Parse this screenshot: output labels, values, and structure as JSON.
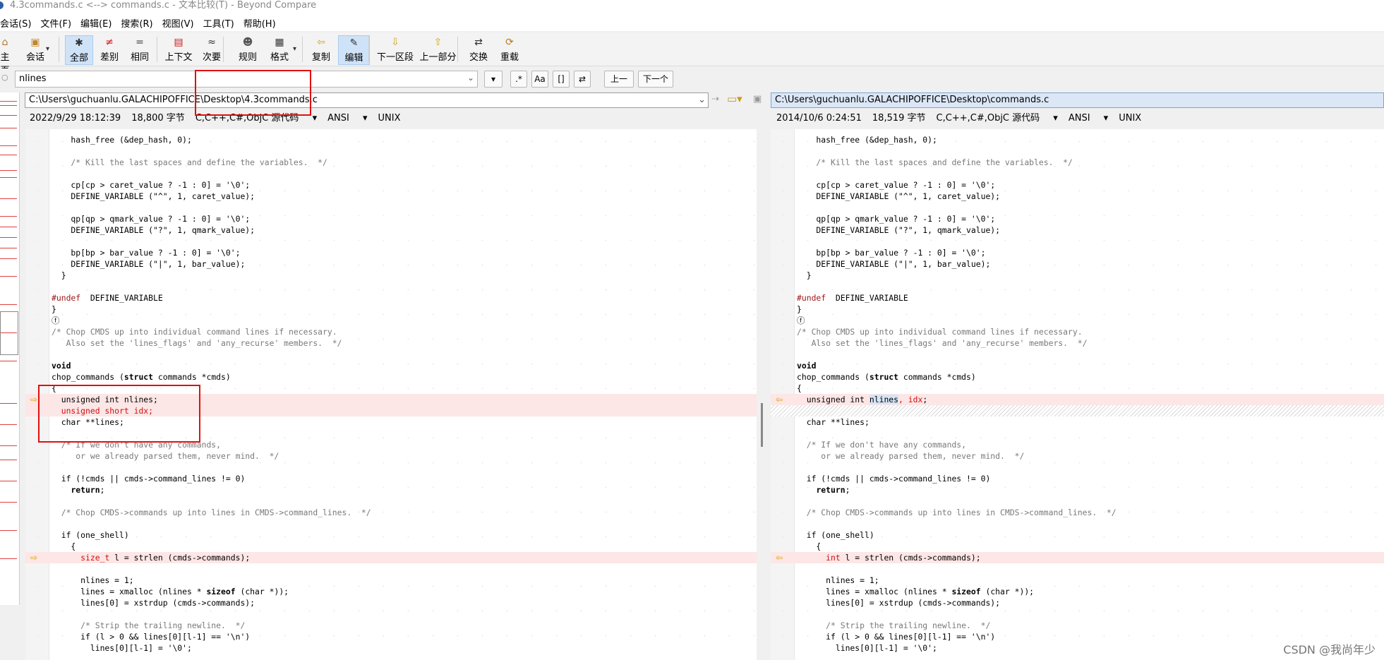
{
  "window": {
    "title": "4.3commands.c <--> commands.c - 文本比较(T) - Beyond Compare"
  },
  "menu": [
    "会话(S)",
    "文件(F)",
    "编辑(E)",
    "搜索(R)",
    "视图(V)",
    "工具(T)",
    "帮助(H)"
  ],
  "toolbar": [
    {
      "id": "home",
      "label": "主页",
      "icon": "home-icon"
    },
    {
      "id": "session",
      "label": "会话",
      "icon": "briefcase-icon"
    },
    {
      "id": "all",
      "label": "全部",
      "icon": "asterisk-icon",
      "active": true
    },
    {
      "id": "diffs",
      "label": "差别",
      "icon": "not-equal-icon"
    },
    {
      "id": "same",
      "label": "相同",
      "icon": "equal-icon"
    },
    {
      "id": "context",
      "label": "上下文",
      "icon": "context-icon"
    },
    {
      "id": "minor",
      "label": "次要",
      "icon": "approx-icon"
    },
    {
      "id": "rules",
      "label": "规则",
      "icon": "referee-icon"
    },
    {
      "id": "format",
      "label": "格式",
      "icon": "format-icon"
    },
    {
      "id": "copy",
      "label": "复制",
      "icon": "copy-arrow-icon"
    },
    {
      "id": "edit",
      "label": "编辑",
      "icon": "pencil-icon",
      "active": true
    },
    {
      "id": "next_section",
      "label": "下一区段",
      "icon": "down-arrow-icon"
    },
    {
      "id": "prev_section",
      "label": "上一部分",
      "icon": "up-arrow-icon"
    },
    {
      "id": "swap",
      "label": "交换",
      "icon": "swap-icon"
    },
    {
      "id": "reload",
      "label": "重载",
      "icon": "reload-icon"
    }
  ],
  "find": {
    "query": "nlines",
    "prev": "上一",
    "next": "下一个",
    "dot_star": ".*",
    "aa": "Aa",
    "word": "[]",
    "wrap": "⇄"
  },
  "left": {
    "path": "C:\\Users\\guchuanlu.GALACHIPOFFICE\\Desktop\\4.3commands.c",
    "date": "2022/9/29 18:12:39",
    "size": "18,800 字节",
    "format": "C,C++,C#,ObjC 源代码",
    "encoding": "ANSI",
    "eol": "UNIX"
  },
  "right": {
    "path": "C:\\Users\\guchuanlu.GALACHIPOFFICE\\Desktop\\commands.c",
    "date": "2014/10/6 0:24:51",
    "size": "18,519 字节",
    "format": "C,C++,C#,ObjC 源代码",
    "encoding": "ANSI",
    "eol": "UNIX"
  },
  "watermark": "CSDN @我尚年少"
}
